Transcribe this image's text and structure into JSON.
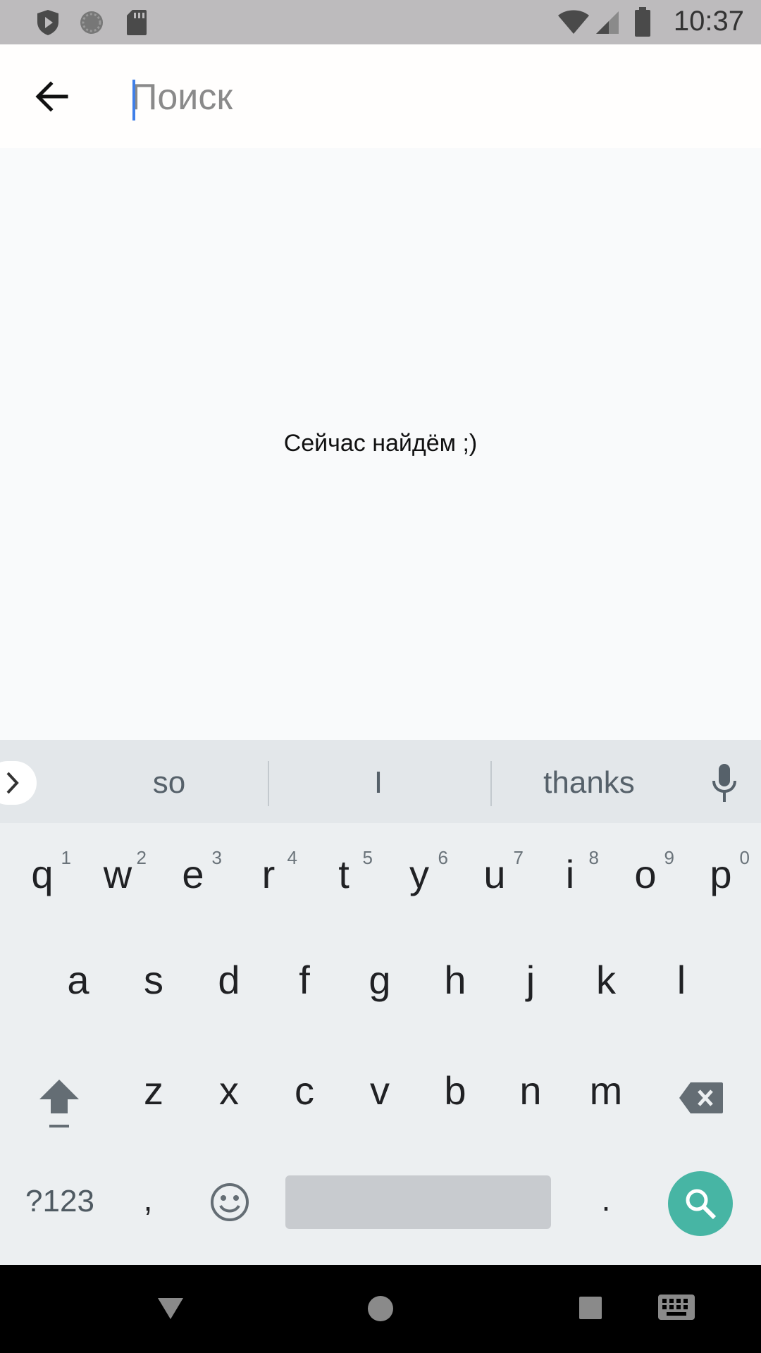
{
  "status_bar": {
    "time": "10:37"
  },
  "search": {
    "placeholder": "Поиск",
    "value": ""
  },
  "main": {
    "message": "Сейчас найдём ;)"
  },
  "keyboard": {
    "suggestions": [
      "so",
      "I",
      "thanks"
    ],
    "row1": [
      {
        "key": "q",
        "hint": "1"
      },
      {
        "key": "w",
        "hint": "2"
      },
      {
        "key": "e",
        "hint": "3"
      },
      {
        "key": "r",
        "hint": "4"
      },
      {
        "key": "t",
        "hint": "5"
      },
      {
        "key": "y",
        "hint": "6"
      },
      {
        "key": "u",
        "hint": "7"
      },
      {
        "key": "i",
        "hint": "8"
      },
      {
        "key": "o",
        "hint": "9"
      },
      {
        "key": "p",
        "hint": "0"
      }
    ],
    "row2": [
      "a",
      "s",
      "d",
      "f",
      "g",
      "h",
      "j",
      "k",
      "l"
    ],
    "row3": [
      "z",
      "x",
      "c",
      "v",
      "b",
      "n",
      "m"
    ],
    "bottom": {
      "symbols": "?123",
      "comma": ",",
      "period": "."
    }
  },
  "icons": {
    "status_left": [
      "shield-play-icon",
      "sync-circle-icon",
      "sd-card-icon"
    ],
    "status_right": [
      "wifi-icon",
      "signal-icon",
      "battery-icon"
    ],
    "nav": [
      "back-triangle-icon",
      "home-circle-icon",
      "recents-square-icon",
      "keyboard-icon"
    ]
  },
  "colors": {
    "accent": "#47b5a4",
    "cursor": "#3f7fe8"
  }
}
